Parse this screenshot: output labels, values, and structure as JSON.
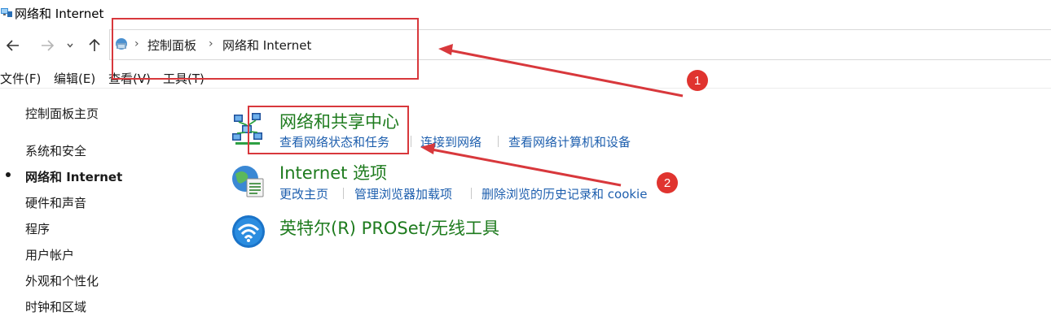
{
  "window": {
    "title": "网络和 Internet",
    "icon": "network-folder-icon"
  },
  "nav": {
    "back_icon": "arrow-left-icon",
    "forward_icon": "arrow-right-icon",
    "recent_icon": "chevron-down-icon",
    "up_icon": "arrow-up-icon",
    "breadcrumb": [
      "控制面板",
      "网络和 Internet"
    ],
    "separator": "›"
  },
  "menu": [
    "文件(F)",
    "编辑(E)",
    "查看(V)",
    "工具(T)"
  ],
  "sidebar": {
    "items": [
      "控制面板主页",
      "系统和安全",
      "网络和 Internet",
      "硬件和声音",
      "程序",
      "用户帐户",
      "外观和个性化",
      "时钟和区域"
    ],
    "active_index": 2
  },
  "categories": [
    {
      "title": "网络和共享中心",
      "icon": "network-sharing-center-icon",
      "links": [
        "查看网络状态和任务",
        "连接到网络",
        "查看网络计算机和设备"
      ]
    },
    {
      "title": "Internet 选项",
      "icon": "internet-options-globe-icon",
      "links": [
        "更改主页",
        "管理浏览器加载项",
        "删除浏览的历史记录和 cookie"
      ]
    },
    {
      "title": "英特尔(R) PROSet/无线工具",
      "icon": "intel-wireless-icon",
      "links": []
    }
  ],
  "annotations": {
    "badges": [
      "1",
      "2"
    ],
    "color": "#d8383c"
  },
  "colors": {
    "category_title": "#1e7b1e",
    "link": "#1e5fae"
  }
}
